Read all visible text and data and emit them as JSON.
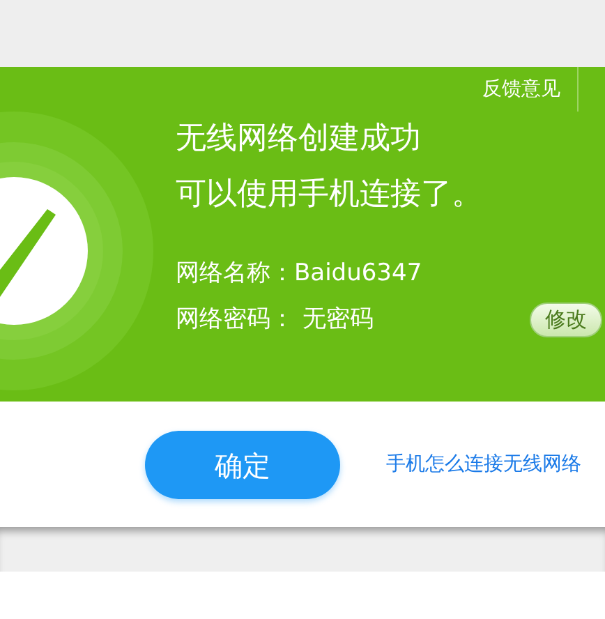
{
  "feedback_link": "反馈意见",
  "title_lines": [
    "无线网络创建成功",
    "可以使用手机连接了。"
  ],
  "fields": [
    {
      "label": "网络名称：",
      "value": "Baidu6347"
    },
    {
      "label": "网络密码：",
      "value": "无密码"
    }
  ],
  "edit_button": "修改",
  "ok_button": "确定",
  "help_link": "手机怎么连接无线网络"
}
